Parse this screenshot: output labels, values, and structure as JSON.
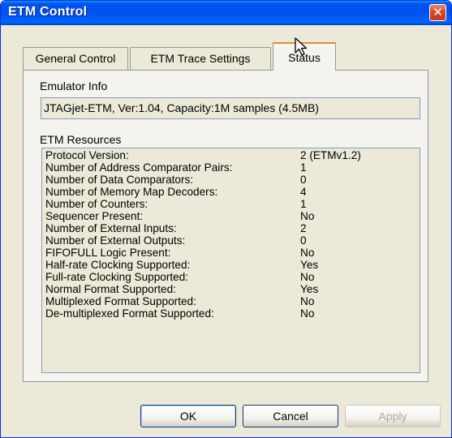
{
  "window": {
    "title": "ETM Control",
    "close_glyph": "✕"
  },
  "tabs": [
    {
      "label": "General Control",
      "active": false
    },
    {
      "label": "ETM Trace Settings",
      "active": false
    },
    {
      "label": "Status",
      "active": true
    }
  ],
  "emulator_info": {
    "label": "Emulator Info",
    "value": "JTAGjet-ETM, Ver:1.04, Capacity:1M samples (4.5MB)"
  },
  "etm_resources": {
    "label": "ETM Resources",
    "rows": [
      {
        "name": "Protocol Version:",
        "value": "2 (ETMv1.2)"
      },
      {
        "name": "Number of Address Comparator Pairs:",
        "value": "1"
      },
      {
        "name": "Number of Data Comparators:",
        "value": "0"
      },
      {
        "name": "Number of Memory Map Decoders:",
        "value": "4"
      },
      {
        "name": "Number of Counters:",
        "value": "1"
      },
      {
        "name": "Sequencer Present:",
        "value": "No"
      },
      {
        "name": "Number of External Inputs:",
        "value": "2"
      },
      {
        "name": "Number of External Outputs:",
        "value": "0"
      },
      {
        "name": "FIFOFULL Logic Present:",
        "value": "No"
      },
      {
        "name": "Half-rate Clocking Supported:",
        "value": "Yes"
      },
      {
        "name": "Full-rate Clocking Supported:",
        "value": "No"
      },
      {
        "name": "Normal Format Supported:",
        "value": "Yes"
      },
      {
        "name": "Multiplexed Format Supported:",
        "value": "No"
      },
      {
        "name": "De-multiplexed Format Supported:",
        "value": "No"
      }
    ]
  },
  "buttons": {
    "ok": "OK",
    "cancel": "Cancel",
    "apply": "Apply"
  },
  "colors": {
    "titlebar": "#0053ee",
    "dialog_bg": "#ece9d8",
    "active_tab_accent": "#e68b2c",
    "close_button": "#d74a25"
  },
  "icons": {
    "close": "close-icon",
    "cursor": "mouse-pointer-icon"
  }
}
